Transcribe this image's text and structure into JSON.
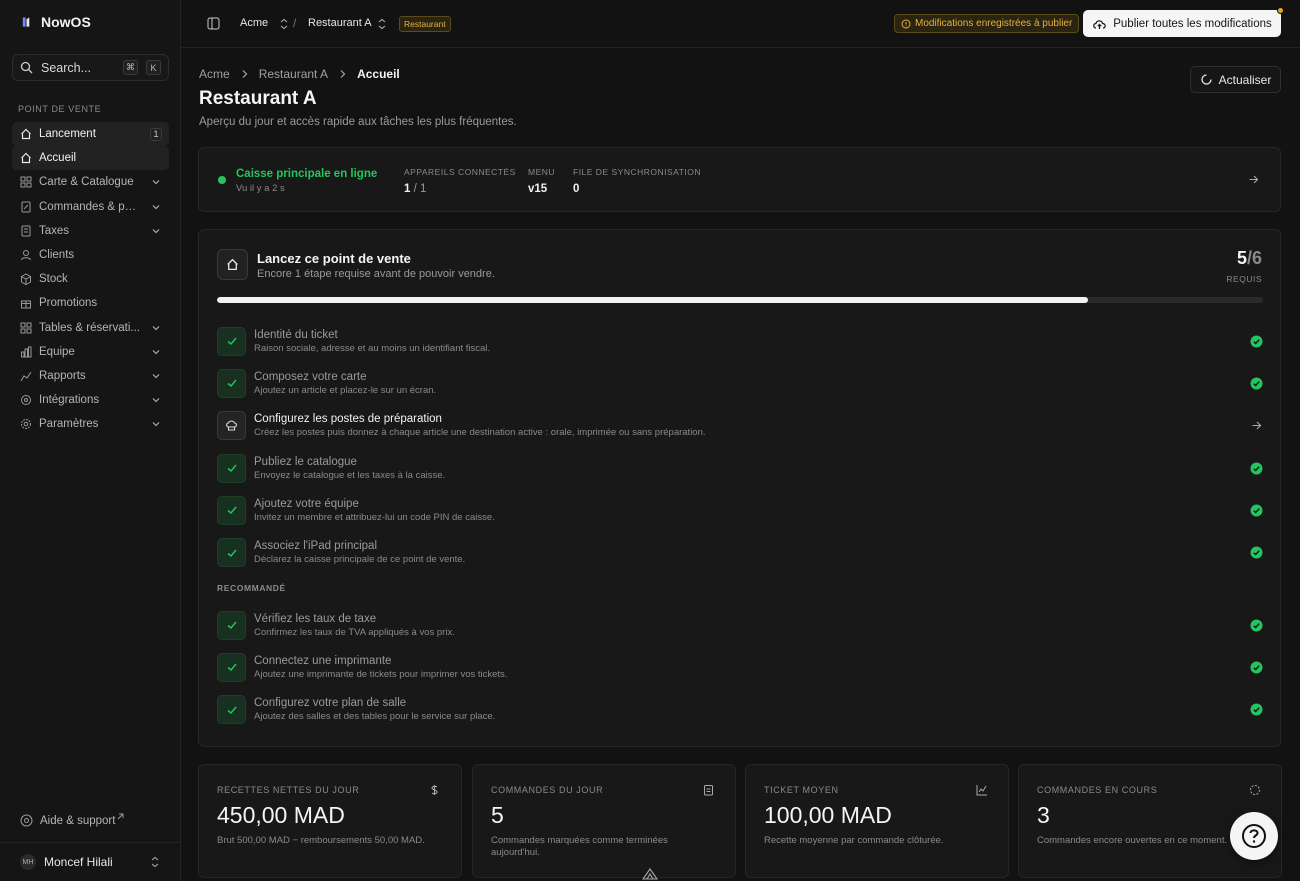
{
  "app": {
    "name": "NowOS"
  },
  "search": {
    "label": "Search...",
    "kbd1": "⌘",
    "kbd2": "K"
  },
  "sidebar": {
    "section": "POINT DE VENTE",
    "items": [
      {
        "label": "Lancement",
        "badge": "1",
        "icon": "rocket-icon"
      },
      {
        "label": "Accueil",
        "icon": "home-icon"
      },
      {
        "label": "Carte & Catalogue",
        "icon": "grid-icon"
      },
      {
        "label": "Commandes & pai...",
        "icon": "receipt-icon"
      },
      {
        "label": "Taxes",
        "icon": "calculator-icon"
      },
      {
        "label": "Clients",
        "icon": "users-icon"
      },
      {
        "label": "Stock",
        "icon": "box-icon"
      },
      {
        "label": "Promotions",
        "icon": "gift-icon"
      },
      {
        "label": "Tables & réservati...",
        "icon": "layout-icon"
      },
      {
        "label": "Équipe",
        "icon": "team-icon"
      },
      {
        "label": "Rapports",
        "icon": "chart-icon"
      },
      {
        "label": "Intégrations",
        "icon": "plug-icon"
      },
      {
        "label": "Paramètres",
        "icon": "gear-icon"
      }
    ],
    "help": "Aide & support",
    "user": {
      "initials": "MH",
      "name": "Moncef Hilali"
    }
  },
  "topbar": {
    "org": "Acme",
    "separator": "/",
    "restaurant": "Restaurant A",
    "tag": "Restaurant",
    "pending": "Modifications enregistrées à publier",
    "publish": "Publier toutes les modifications"
  },
  "breadcrumb": {
    "b1": "Acme",
    "b2": "Restaurant A",
    "current": "Accueil"
  },
  "page": {
    "title": "Restaurant A",
    "subtitle": "Aperçu du jour et accès rapide aux tâches les plus fréquentes.",
    "refresh": "Actualiser"
  },
  "status": {
    "title": "Caisse principale en ligne",
    "seen": "Vu il y a 2 s",
    "devices_label": "APPAREILS CONNECTÉS",
    "devices_val": "1",
    "devices_total": "/ 1",
    "menu_label": "MENU",
    "menu_val": "v15",
    "sync_label": "FILE DE SYNCHRONISATION",
    "sync_val": "0"
  },
  "launch": {
    "title": "Lancez ce point de vente",
    "subtitle": "Encore 1 étape requise avant de pouvoir vendre.",
    "done": "5",
    "total": "/6",
    "req_label": "REQUIS",
    "progress_fraction": 0.833,
    "recommended_label": "RECOMMANDÉ",
    "required_steps": [
      {
        "title": "Identité du ticket",
        "desc": "Raison sociale, adresse et au moins un identifiant fiscal.",
        "done": true
      },
      {
        "title": "Composez votre carte",
        "desc": "Ajoutez un article et placez-le sur un écran.",
        "done": true
      },
      {
        "title": "Configurez les postes de préparation",
        "desc": "Créez les postes puis donnez à chaque article une destination active : orale, imprimée ou sans préparation.",
        "done": false
      },
      {
        "title": "Publiez le catalogue",
        "desc": "Envoyez le catalogue et les taxes à la caisse.",
        "done": true
      },
      {
        "title": "Ajoutez votre équipe",
        "desc": "Invitez un membre et attribuez-lui un code PIN de caisse.",
        "done": true
      },
      {
        "title": "Associez l'iPad principal",
        "desc": "Déclarez la caisse principale de ce point de vente.",
        "done": true
      }
    ],
    "recommended_steps": [
      {
        "title": "Vérifiez les taux de taxe",
        "desc": "Confirmez les taux de TVA appliqués à vos prix.",
        "done": true
      },
      {
        "title": "Connectez une imprimante",
        "desc": "Ajoutez une imprimante de tickets pour imprimer vos tickets.",
        "done": true
      },
      {
        "title": "Configurez votre plan de salle",
        "desc": "Ajoutez des salles et des tables pour le service sur place.",
        "done": true
      }
    ]
  },
  "kpis": [
    {
      "label": "RECETTES NETTES DU JOUR",
      "value": "450,00 MAD",
      "desc": "Brut 500,00 MAD − remboursements 50,00 MAD.",
      "icon": "dollar-icon"
    },
    {
      "label": "COMMANDES DU JOUR",
      "value": "5",
      "desc": "Commandes marquées comme terminées aujourd'hui.",
      "icon": "clipboard-icon"
    },
    {
      "label": "TICKET MOYEN",
      "value": "100,00 MAD",
      "desc": "Recette moyenne par commande clôturée.",
      "icon": "trend-icon"
    },
    {
      "label": "COMMANDES EN COURS",
      "value": "3",
      "desc": "Commandes encore ouvertes en ce moment.",
      "icon": "loader-icon"
    }
  ],
  "colors": {
    "success": "#22c55e",
    "warning": "#e3b341",
    "background": "#121212",
    "card": "#181818"
  }
}
